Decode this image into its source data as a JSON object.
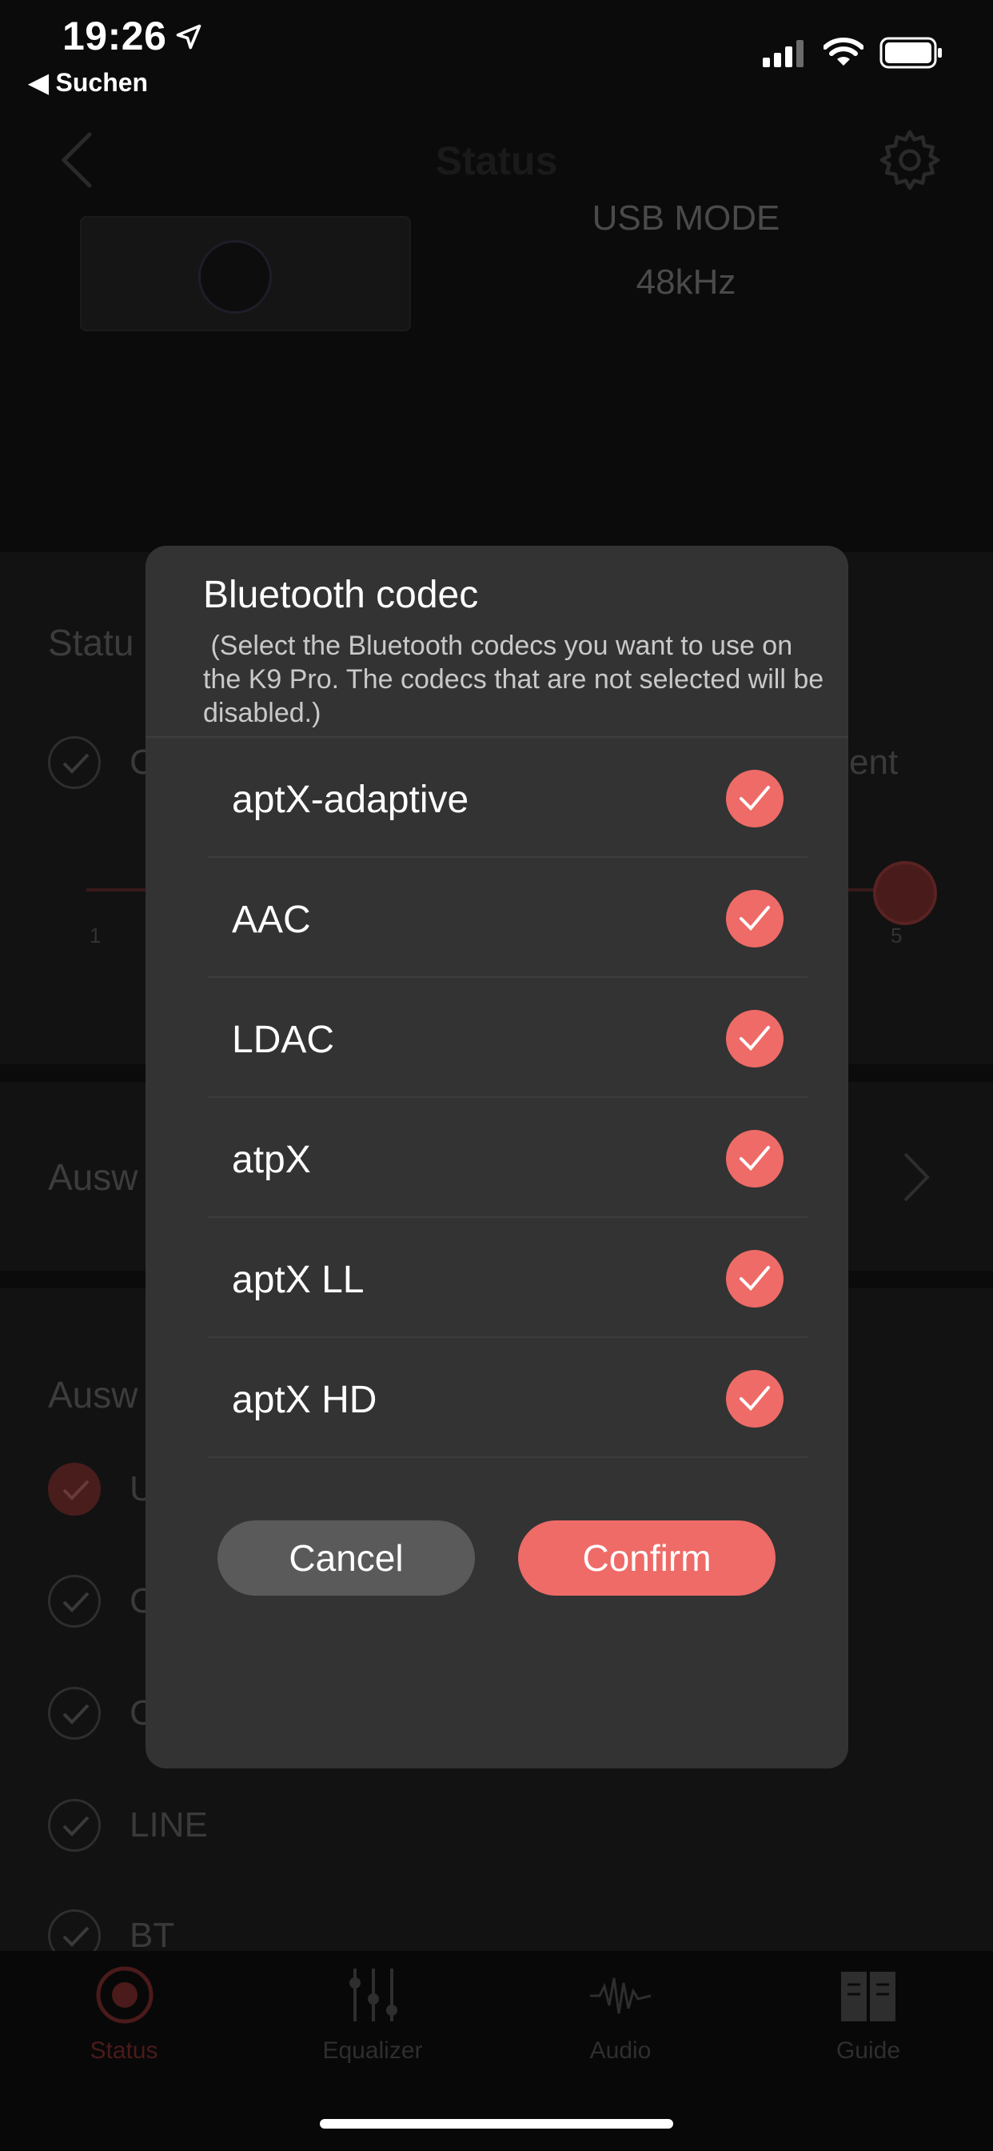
{
  "status_bar": {
    "time": "19:26",
    "back_label": "◀ Suchen",
    "icons": [
      "location-arrow-icon",
      "cellular-signal-icon",
      "wifi-icon",
      "battery-icon"
    ]
  },
  "nav": {
    "title": "Status",
    "back_icon": "chevron-left-icon",
    "settings_icon": "gear-icon"
  },
  "device": {
    "mode": "USB MODE",
    "rate": "48kHz"
  },
  "background": {
    "status_label": "Statu",
    "option_left": "C",
    "option_right": "ent",
    "slider_min": "1",
    "slider_max": "5",
    "auswahl_label": "Ausw",
    "auswahl2_label": "Ausw",
    "inputs": [
      {
        "label": "U",
        "checked": true
      },
      {
        "label": "C",
        "checked": false
      },
      {
        "label": "C",
        "checked": false
      },
      {
        "label": "LINE",
        "checked": false
      },
      {
        "label": "BT",
        "checked": false
      }
    ]
  },
  "tabs": [
    {
      "label": "Status",
      "icon": "status-record-icon",
      "active": true
    },
    {
      "label": "Equalizer",
      "icon": "equalizer-sliders-icon",
      "active": false
    },
    {
      "label": "Audio",
      "icon": "audio-waveform-icon",
      "active": false
    },
    {
      "label": "Guide",
      "icon": "book-icon",
      "active": false
    }
  ],
  "dialog": {
    "title": "Bluetooth codec",
    "description": " (Select the Bluetooth codecs you want to use on the K9 Pro. The codecs that are not selected will be disabled.)",
    "codecs": [
      {
        "label": "aptX-adaptive",
        "checked": true
      },
      {
        "label": "AAC",
        "checked": true
      },
      {
        "label": "LDAC",
        "checked": true
      },
      {
        "label": "atpX",
        "checked": true
      },
      {
        "label": "aptX LL",
        "checked": true
      },
      {
        "label": "aptX HD",
        "checked": true
      }
    ],
    "cancel_label": "Cancel",
    "confirm_label": "Confirm",
    "accent_color": "#ee6b67"
  }
}
